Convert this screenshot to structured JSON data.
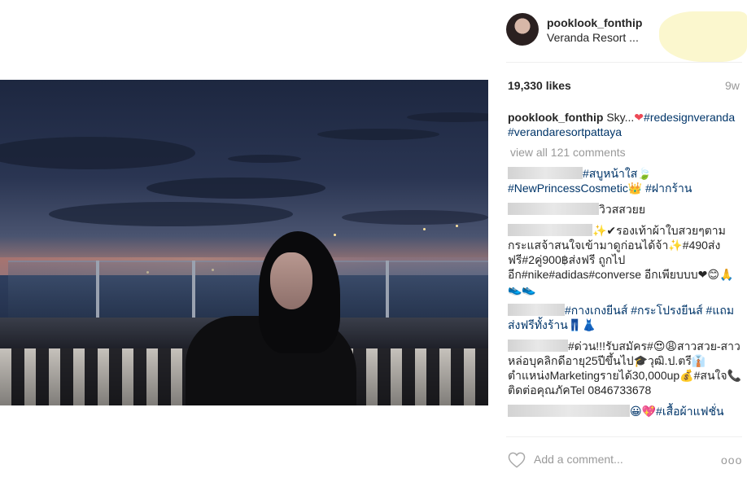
{
  "post": {
    "username": "pooklook_fonthip",
    "location": "Veranda Resort ...",
    "likes": "19,330 likes",
    "age": "9w",
    "caption": {
      "username": "pooklook_fonthip",
      "text": " Sky...",
      "emoji": "❤",
      "tags": "#redesignveranda #verandaresortpattaya"
    },
    "view_all": "view all 121 comments"
  },
  "comments": [
    {
      "text": "#สบูหน้าใส🍃 #NewPrincessCosmetic👑 #ฝากร้าน"
    },
    {
      "text": "วิวสสวยย"
    },
    {
      "text": "✨✔รองเท้าผ้าใบสวยๆตามกระแสจ้าสนใจเข้ามาดูก่อนได้จ้า✨#490ส่งฟรี#2คู่900฿ส่งฟรี ถูกไปอีก#nike#adidas#converse อีกเพียบบบ❤😊🙏👟👟"
    },
    {
      "text": "#กางเกงยีนส์ #กระโปรงยีนส์ #แถมส่งฟรีทั้งร้าน👖👗"
    },
    {
      "text": "#ด่วน!!!รับสมัคร#😍😩สาวสวย-สาวหล่อบุคลิกดีอายุ25ปีขึ้นไป🎓วุฒิ.ป.ตรี👔ตำแหน่งMarketingรายได้30,000up💰#สนใจ📞ติดต่อคุณภัคTel 0846733678"
    },
    {
      "text": "😀💖#เสื้อผ้าแฟชั่น"
    }
  ],
  "composer": {
    "placeholder": "Add a comment...",
    "more": "ooo"
  },
  "icons": {
    "like": "heart-outline-icon",
    "more": "more-options-icon"
  }
}
